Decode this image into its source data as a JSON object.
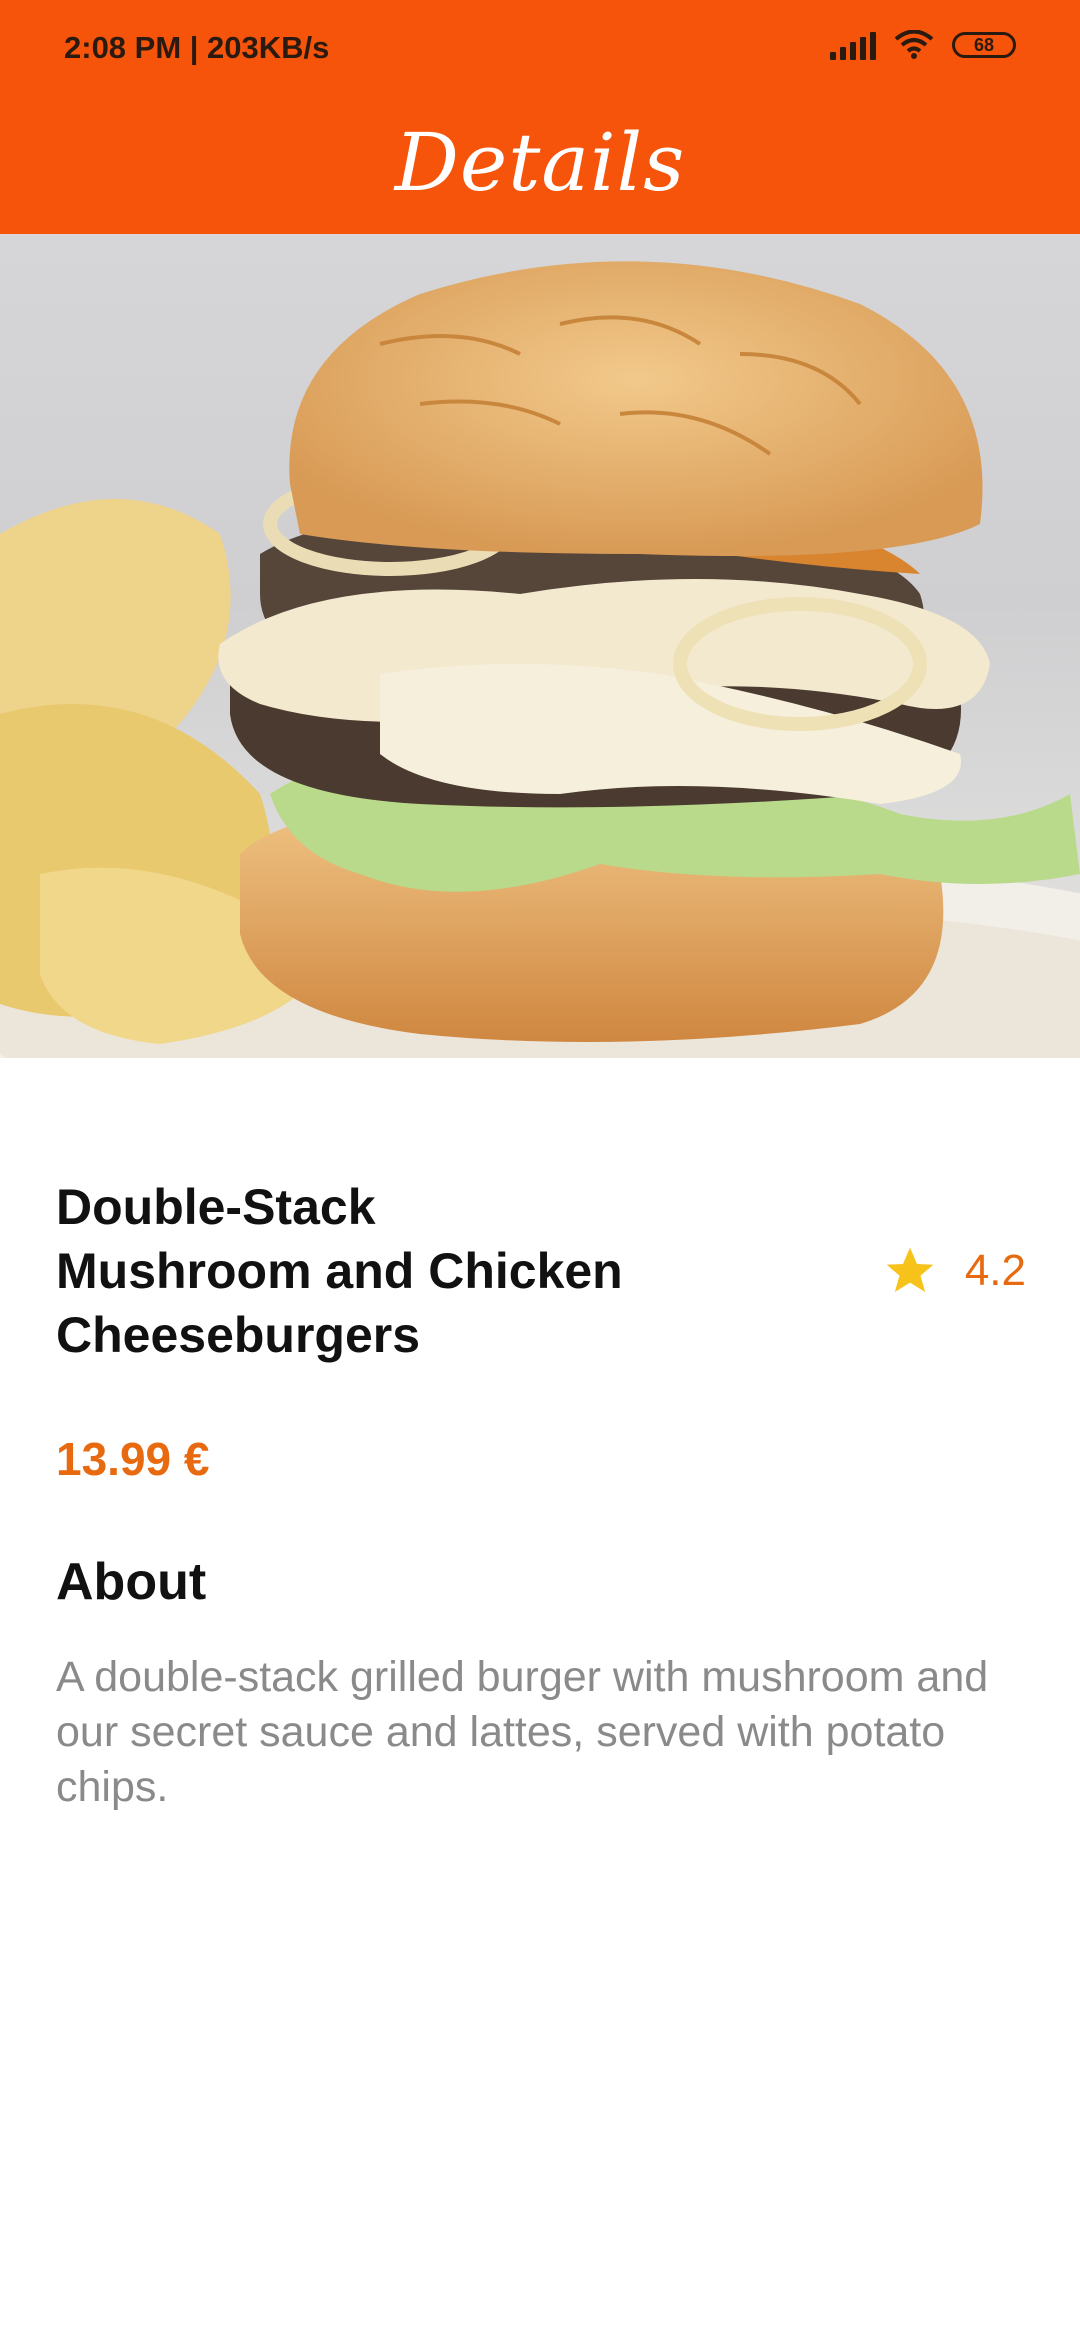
{
  "status_bar": {
    "time": "2:08 PM | 203KB/s",
    "battery": "68",
    "icons": [
      "signal-icon",
      "wifi-icon",
      "battery-icon"
    ]
  },
  "app_bar": {
    "title": "Details"
  },
  "product": {
    "image": "burger-photo",
    "title_lines": [
      "Double-Stack",
      "Mushroom and Chicken",
      "Cheeseburgers"
    ],
    "rating": "4.2",
    "price": "13.99 €"
  },
  "about": {
    "heading": "About",
    "text": "A double-stack grilled burger with mushroom and our secret sauce and lattes, served with potato chips."
  },
  "colors": {
    "accent": "#f5540a",
    "price_orange": "#e86a10",
    "star": "#f7c21a"
  }
}
